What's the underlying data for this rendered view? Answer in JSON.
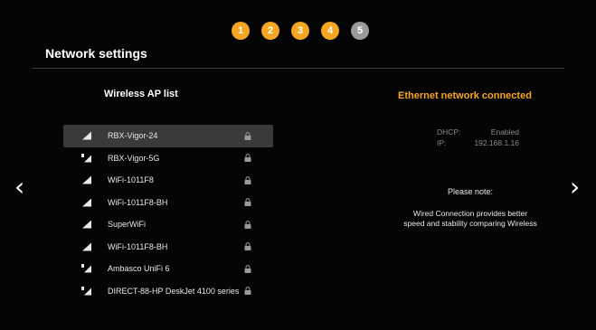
{
  "stepper": {
    "steps": [
      {
        "label": "1",
        "state": "active"
      },
      {
        "label": "2",
        "state": "active"
      },
      {
        "label": "3",
        "state": "active"
      },
      {
        "label": "4",
        "state": "active"
      },
      {
        "label": "5",
        "state": "inactive"
      }
    ]
  },
  "header": {
    "title": "Network settings"
  },
  "nav": {
    "prev_icon": "chevron-left-icon",
    "next_icon": "chevron-right-icon",
    "prev_glyph": "‹",
    "next_glyph": "›"
  },
  "wireless": {
    "title": "Wireless AP list",
    "networks": [
      {
        "name": "RBX-Vigor-24",
        "icon": "wifi-signal-icon",
        "locked": true,
        "selected": true
      },
      {
        "name": "RBX-Vigor-5G",
        "icon": "wifi-5g-signal-icon",
        "locked": true,
        "selected": false
      },
      {
        "name": "WiFi-1011F8",
        "icon": "wifi-signal-icon",
        "locked": true,
        "selected": false
      },
      {
        "name": "WiFi-1011F8-BH",
        "icon": "wifi-signal-icon",
        "locked": true,
        "selected": false
      },
      {
        "name": "SuperWiFi",
        "icon": "wifi-signal-icon",
        "locked": true,
        "selected": false
      },
      {
        "name": "WiFi-1011F8-BH",
        "icon": "wifi-signal-icon",
        "locked": true,
        "selected": false
      },
      {
        "name": "Ambasco UniFi 6",
        "icon": "wifi-5g-signal-icon",
        "locked": true,
        "selected": false
      },
      {
        "name": "DIRECT-88-HP DeskJet 4100 series",
        "icon": "wifi-5g-signal-icon",
        "locked": true,
        "selected": false
      }
    ]
  },
  "ethernet": {
    "title": "Ethernet network connected",
    "dhcp_label": "DHCP:",
    "dhcp_value": "Enabled",
    "ip_label": "IP:",
    "ip_value": "192.168.1.16"
  },
  "note": {
    "title": "Please note:",
    "body": "Wired Connection provides better speed and stability comparing Wireless"
  },
  "colors": {
    "accent": "#f5a623",
    "inactive_step": "#9a9a9a",
    "selected_row": "#3a3a3a",
    "muted_text": "#8a8a8a"
  }
}
